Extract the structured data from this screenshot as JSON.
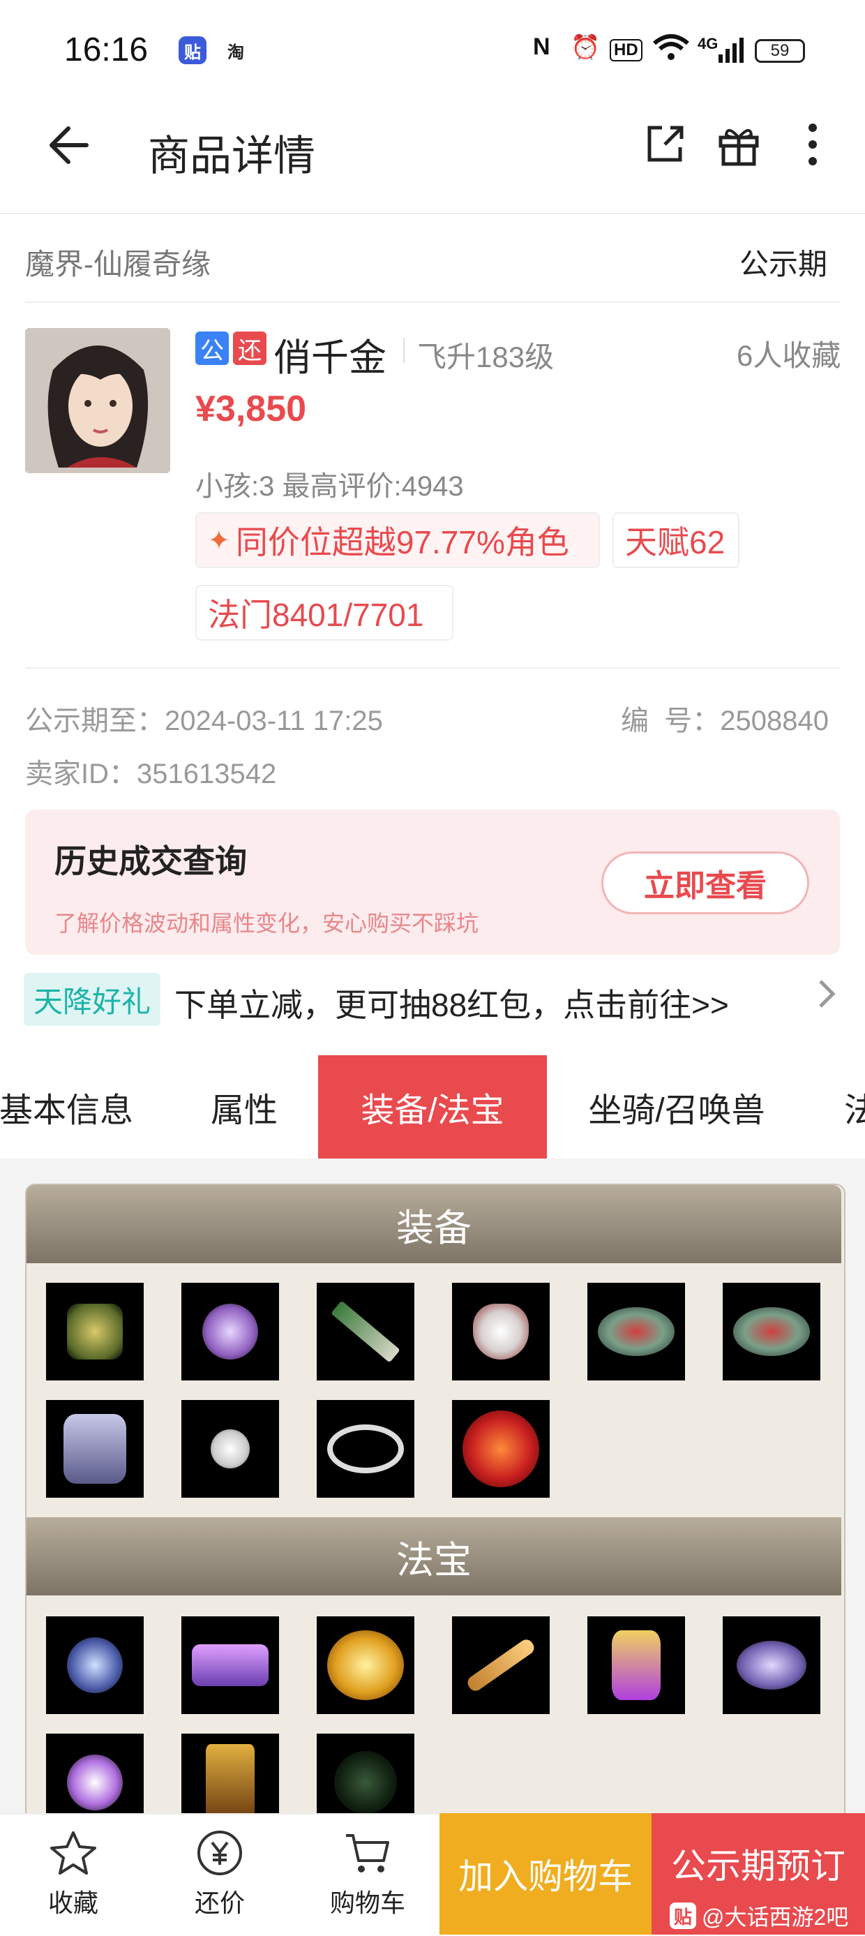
{
  "status_bar": {
    "time": "16:16",
    "app_icon_1": "贴",
    "app_icon_2": "淘",
    "hd": "HD",
    "network": "4G",
    "battery": "59"
  },
  "nav": {
    "title": "商品详情",
    "icons": [
      "back-arrow-icon",
      "share-icon",
      "gift-icon",
      "more-icon"
    ]
  },
  "listing": {
    "game": "魔界-仙履奇缘",
    "period": "公示期",
    "tags": [
      "公",
      "还"
    ],
    "name": "俏千金",
    "level": "飞升183级",
    "favorites": "6人收藏",
    "price": "¥3,850",
    "sub": "小孩:3 最高评价:4943",
    "chips": [
      "同价位超越97.77%角色",
      "天赋62",
      "法门8401/7701"
    ],
    "public_until": "公示期至：2024-03-11 17:25",
    "number": "编  号：2508840",
    "seller": "卖家ID：351613542"
  },
  "history": {
    "title": "历史成交查询",
    "subtitle": "了解价格波动和属性变化，安心购买不踩坑",
    "button": "立即查看"
  },
  "promo": {
    "tag": "天降好礼",
    "text": "下单立减，更可抽88红包，点击前往>>"
  },
  "tabs": [
    "基本信息",
    "属性",
    "装备/法宝",
    "坐骑/召唤兽",
    "法"
  ],
  "active_tab": "装备/法宝",
  "equipment": {
    "title": "装备",
    "items": [
      "boots",
      "necklace",
      "weapon",
      "mask",
      "ring-skull",
      "ring-skull",
      "armor",
      "skull-pendant",
      "skull-bracelet",
      "red-orb"
    ]
  },
  "treasures": {
    "title": "法宝",
    "items": [
      "claw",
      "scroll",
      "golden-orb",
      "flute",
      "lantern",
      "fan",
      "staff",
      "tablet",
      "dark-orb"
    ]
  },
  "bottom_bar": {
    "favorite": "收藏",
    "bargain": "还价",
    "cart": "购物车",
    "add_cart": "加入购物车",
    "preorder": "公示期预订",
    "watermark": "@大话西游2吧",
    "watermark_badge": "贴"
  },
  "colors": {
    "accent": "#e84a4e",
    "gold": "#f0ad1f",
    "teal": "#1bb3a8"
  }
}
